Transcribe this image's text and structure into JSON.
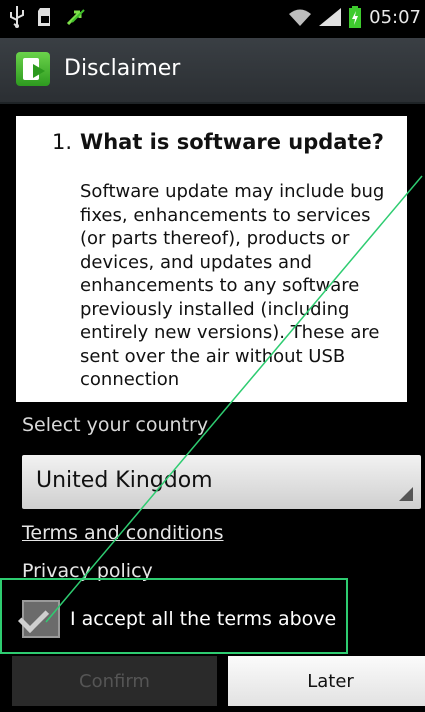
{
  "status_bar": {
    "time": "05:07",
    "icons": [
      "usb-icon",
      "sd-card-icon",
      "sync-arrows-icon",
      "wifi-icon",
      "signal-icon",
      "battery-charging-icon"
    ]
  },
  "header": {
    "title": "Disclaimer",
    "icon": "software-update-icon"
  },
  "content": {
    "section_number": "1.",
    "section_title": "What is software update?",
    "paragraph": "Software update may include bug fixes, enhancements to services (or parts thereof), products or devices, and updates and enhancements to any software previously installed (including entirely new versions). These are sent over the air without USB connection"
  },
  "country": {
    "label": "Select your country",
    "selected": "United Kingdom"
  },
  "links": {
    "terms": "Terms and conditions",
    "privacy": "Privacy policy"
  },
  "accept": {
    "label": "I accept all the terms above",
    "checked": true
  },
  "buttons": {
    "confirm": "Confirm",
    "later": "Later"
  },
  "colors": {
    "highlight": "#2ecc71",
    "titlebar": "#2f3337"
  }
}
